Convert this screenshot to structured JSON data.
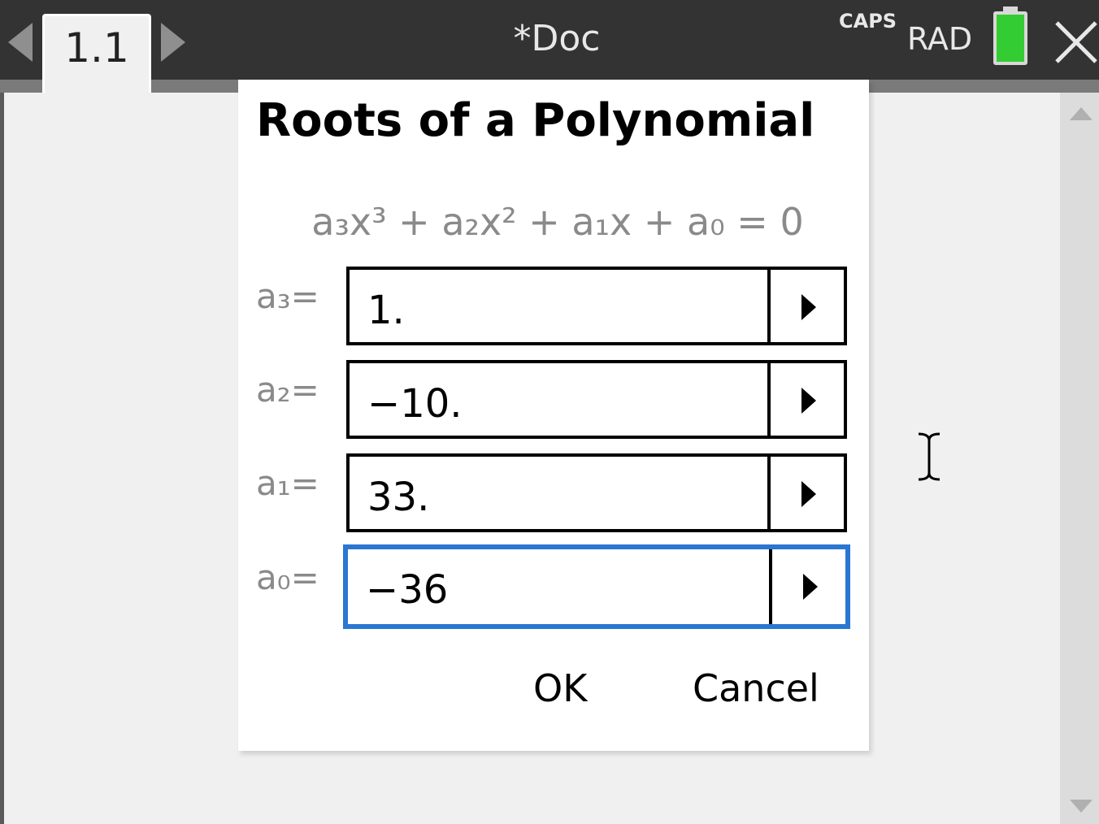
{
  "topbar": {
    "tab_label": "1.1",
    "doc_title": "*Doc",
    "caps_label": "CAPS",
    "angle_mode": "RAD",
    "battery_color": "#33cc33"
  },
  "dialog": {
    "title": "Roots of a Polynomial",
    "equation": "a₃x³ + a₂x² + a₁x + a₀ = 0",
    "fields": [
      {
        "label": "a₃=",
        "value": "1."
      },
      {
        "label": "a₂=",
        "value": "−10."
      },
      {
        "label": "a₁=",
        "value": "33."
      },
      {
        "label": "a₀=",
        "value": "−36"
      }
    ],
    "ok_label": "OK",
    "cancel_label": "Cancel",
    "focus_color": "#2a76d2"
  }
}
